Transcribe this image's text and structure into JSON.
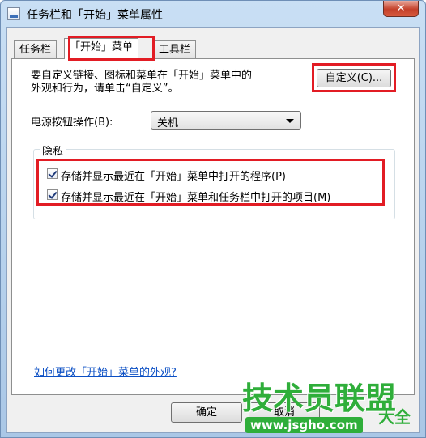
{
  "window": {
    "title": "任务栏和「开始」菜单属性",
    "close_glyph": "✕"
  },
  "tabs": [
    {
      "label": "任务栏",
      "active": false
    },
    {
      "label": "「开始」菜单",
      "active": true
    },
    {
      "label": "工具栏",
      "active": false
    }
  ],
  "start_menu": {
    "description_line1": "要自定义链接、图标和菜单在「开始」菜单中的",
    "description_line2": "外观和行为，请单击“自定义”。",
    "customize_button": "自定义(C)...",
    "power_label": "电源按钮操作(B):",
    "power_selected": "关机",
    "privacy_title": "隐私",
    "checkboxes": [
      {
        "label": "存储并显示最近在「开始」菜单中打开的程序(P)",
        "checked": true
      },
      {
        "label": "存储并显示最近在「开始」菜单和任务栏中打开的项目(M)",
        "checked": true
      }
    ],
    "help_link": "如何更改「开始」菜单的外观?"
  },
  "footer": {
    "ok_button": "确定",
    "cancel_button": "取消"
  },
  "watermark": {
    "main": "技术员联盟",
    "side": "大全",
    "url": "www.jsgho.com"
  },
  "colors": {
    "highlight": "#e21c24",
    "link": "#0b4fc4",
    "watermark": "#2fae3a"
  }
}
